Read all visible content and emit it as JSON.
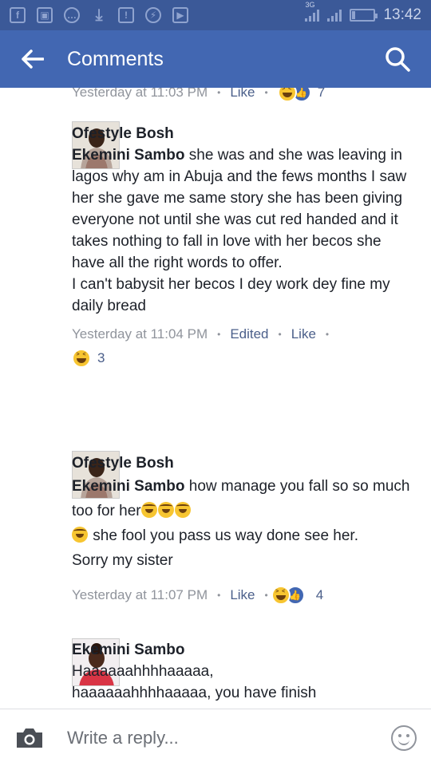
{
  "status_bar": {
    "network": "3G",
    "time": "13:42",
    "battery_level": 0.15
  },
  "app_bar": {
    "title": "Comments"
  },
  "comments": [
    {
      "meta": {
        "time": "Yesterday at 11:03 PM",
        "like": "Like",
        "reaction_count": "7"
      }
    },
    {
      "author": "Ofestyle Bosh",
      "mention": "Ekemini Sambo",
      "text": " she was and she was leaving in lagos why am in Abuja and the fews months I saw her she gave me same story she has been giving everyone not until she was cut red handed and it takes nothing to fall in love with her becos she have all the right words to offer.",
      "text2": "I can't babysit her becos I dey work dey fine my daily bread",
      "meta": {
        "time": "Yesterday at 11:04 PM",
        "edited": "Edited",
        "like": "Like"
      },
      "reaction_count": "3"
    },
    {
      "author": "Ofestyle Bosh",
      "mention": "Ekemini Sambo",
      "text": " how manage you fall so so much too for her",
      "text2": " she fool you pass us way done see her.",
      "text3": "Sorry my sister",
      "meta": {
        "time": "Yesterday at 11:07 PM",
        "like": "Like",
        "reaction_count": "4"
      }
    },
    {
      "author": "Ekemini Sambo",
      "text": "Haaaaaahhhhaaaaa,",
      "text2": "haaaaaahhhhaaaaa, you have finish"
    }
  ],
  "reply_bar": {
    "placeholder": "Write a reply..."
  },
  "colors": {
    "status_bar": "#3b5998",
    "app_bar": "#4267b2",
    "link": "#4b5f8a",
    "meta": "#90949c"
  }
}
